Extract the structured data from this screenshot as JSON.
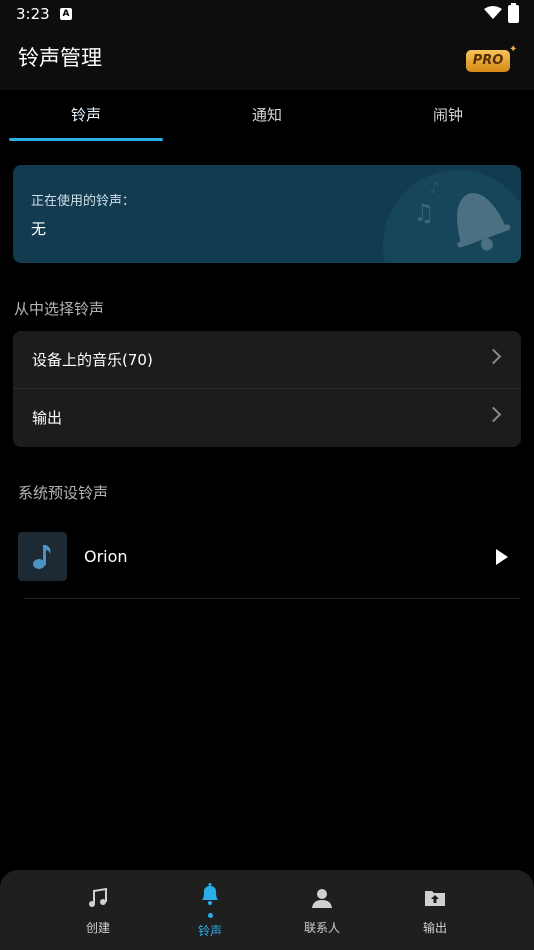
{
  "status": {
    "time": "3:23",
    "app_icon_letter": "A"
  },
  "header": {
    "title": "铃声管理",
    "badge": "PRO"
  },
  "tabs": [
    {
      "label": "铃声",
      "active": true
    },
    {
      "label": "通知",
      "active": false
    },
    {
      "label": "闹钟",
      "active": false
    }
  ],
  "current": {
    "label": "正在使用的铃声：",
    "value": "无"
  },
  "choose": {
    "heading": "从中选择铃声",
    "items": [
      {
        "label": "设备上的音乐(70)"
      },
      {
        "label": "输出"
      }
    ]
  },
  "presets": {
    "heading": "系统预设铃声",
    "items": [
      {
        "name": "Orion"
      }
    ]
  },
  "bottom_nav": [
    {
      "label": "创建",
      "icon": "music-note-icon",
      "active": false
    },
    {
      "label": "铃声",
      "icon": "bell-icon",
      "active": true
    },
    {
      "label": "联系人",
      "icon": "contact-icon",
      "active": false
    },
    {
      "label": "输出",
      "icon": "folder-upload-icon",
      "active": false
    }
  ],
  "colors": {
    "accent": "#2aaee8",
    "card": "#133b4f",
    "pro": "#f6b13c"
  }
}
